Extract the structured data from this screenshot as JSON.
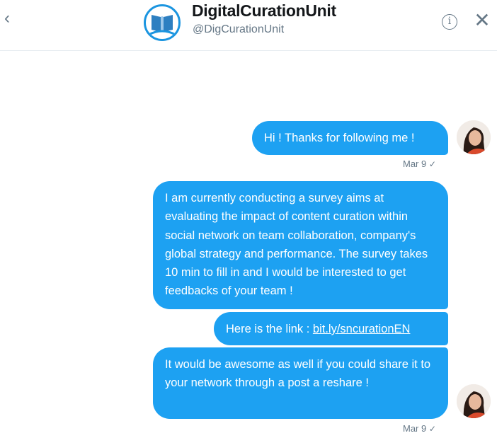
{
  "header": {
    "back_glyph": "‹",
    "name": "DigitalCurationUnit",
    "handle": "@DigCurationUnit",
    "info_glyph": "i",
    "close_glyph": "✕"
  },
  "messages": [
    {
      "text": "Hi ! Thanks for following me !"
    },
    {
      "text": "I am currently conducting a survey aims at evaluating the impact of content curation within social network on team collaboration, company's global strategy and performance. The survey takes 10 min to fill in and I would be interested to get feedbacks of your team !"
    },
    {
      "prefix": "Here is the link : ",
      "link": "bit.ly/sncurationEN"
    },
    {
      "text": "It would be awesome as well if you could share it to your network through a post a reshare !"
    }
  ],
  "timestamps": [
    {
      "date": "Mar 9",
      "status": "✓"
    },
    {
      "date": "Mar 9",
      "status": "✓"
    }
  ],
  "colors": {
    "bubble": "#1da1f2",
    "accent": "#1b95e0",
    "muted": "#657786"
  },
  "icons": [
    "chevron-left-icon",
    "info-icon",
    "close-icon",
    "book-icon"
  ]
}
